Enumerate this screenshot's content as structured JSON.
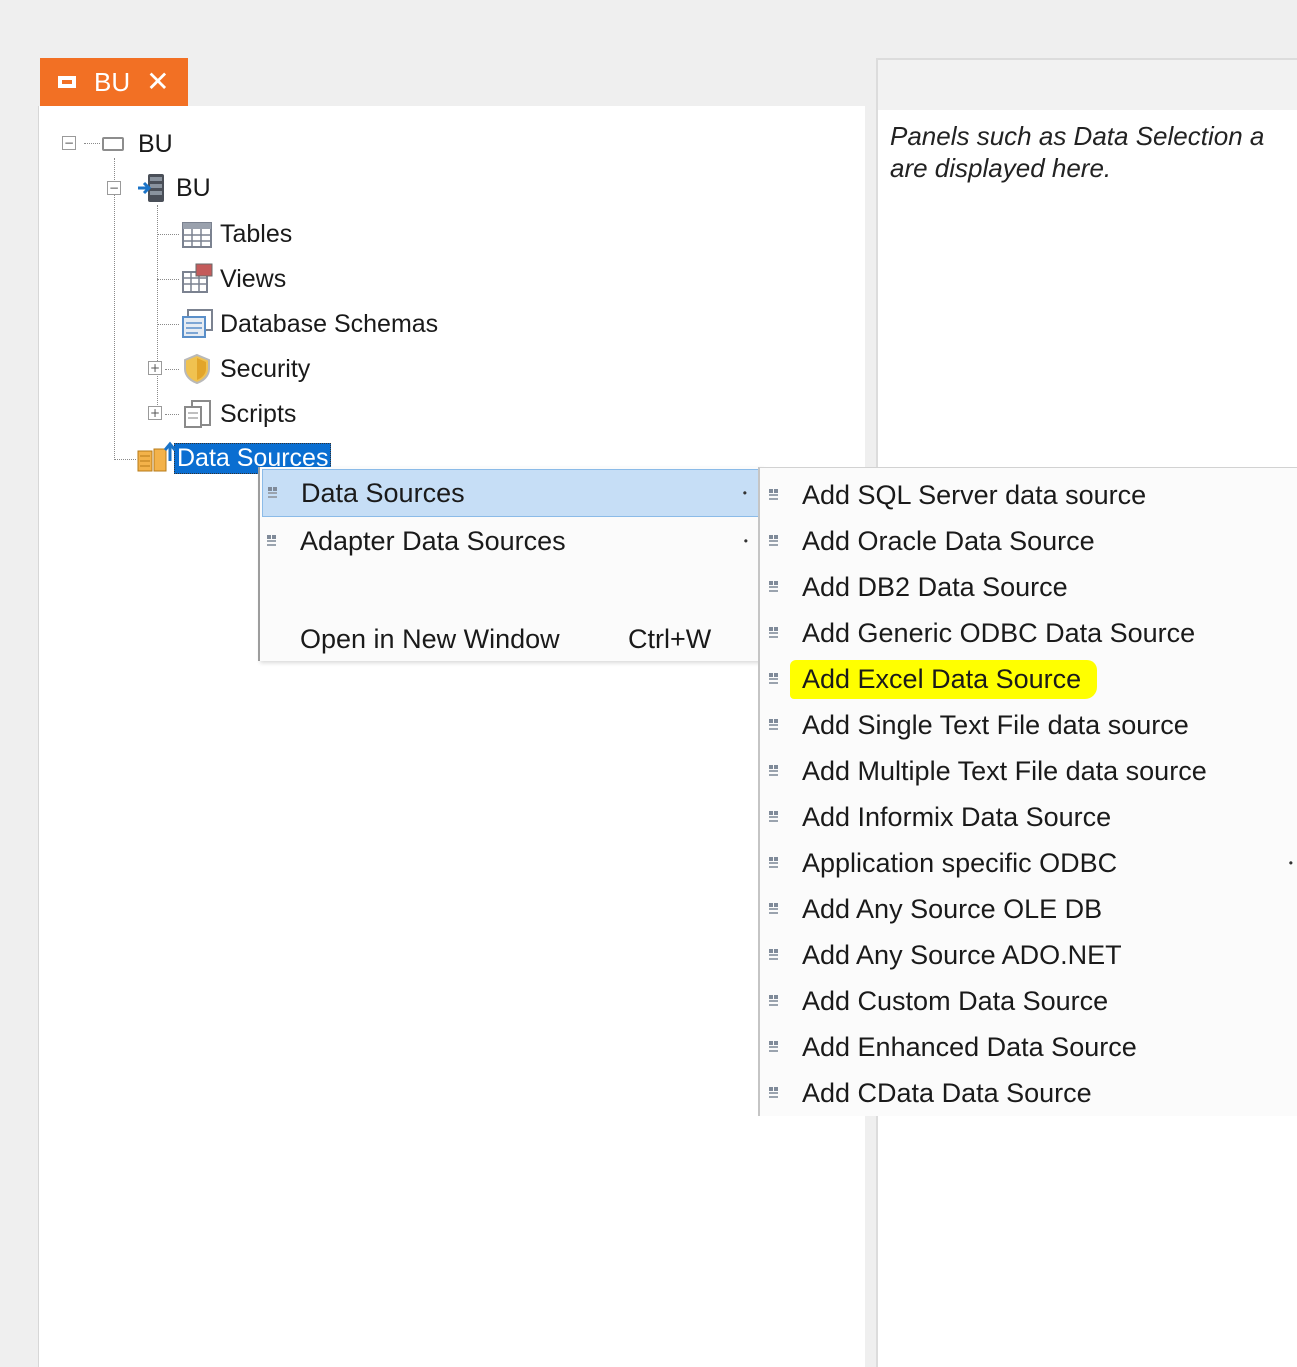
{
  "tab": {
    "label": "BU",
    "close": "✕"
  },
  "right_panel": {
    "hint": "Panels such as Data Selection a\nare displayed here."
  },
  "tree": {
    "root": {
      "label": "BU",
      "expander": "−"
    },
    "db": {
      "label": "BU",
      "expander": "−"
    },
    "children": [
      {
        "label": "Tables"
      },
      {
        "label": "Views"
      },
      {
        "label": "Database Schemas"
      },
      {
        "label": "Security",
        "expander": "+"
      },
      {
        "label": "Scripts",
        "expander": "+"
      }
    ],
    "data_sources": {
      "label": "Data Sources"
    }
  },
  "context_menu": {
    "items": [
      {
        "label": "Data Sources",
        "arrow": "•",
        "highlighted": true
      },
      {
        "label": "Adapter Data Sources",
        "arrow": "•"
      },
      {
        "label": "Open in New Window",
        "shortcut": "Ctrl+W"
      }
    ]
  },
  "submenu": {
    "items": [
      {
        "label": "Add SQL Server data source"
      },
      {
        "label": "Add Oracle Data Source"
      },
      {
        "label": "Add DB2 Data Source"
      },
      {
        "label": "Add Generic ODBC Data Source"
      },
      {
        "label": "Add Excel Data Source",
        "highlight": "#ffff00"
      },
      {
        "label": "Add Single Text File data source"
      },
      {
        "label": "Add Multiple Text File data source"
      },
      {
        "label": "Add Informix Data Source"
      },
      {
        "label": "Application specific ODBC",
        "arrow": "•"
      },
      {
        "label": "Add Any Source OLE DB"
      },
      {
        "label": "Add Any Source ADO.NET"
      },
      {
        "label": "Add Custom Data Source"
      },
      {
        "label": "Add Enhanced Data Source"
      },
      {
        "label": "Add CData Data Source"
      }
    ]
  },
  "colors": {
    "tab": "#f27024",
    "selection": "#0a6ed1",
    "menu_highlight": "#c6def6",
    "marker": "#ffff00"
  }
}
